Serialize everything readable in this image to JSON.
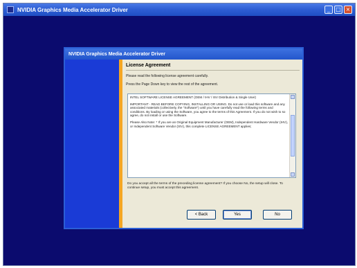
{
  "window": {
    "title": "NVIDIA Graphics Media Accelerator Driver",
    "minimize": "_",
    "maximize": "□",
    "close": "×"
  },
  "dialog": {
    "title": "NVIDIA Graphics Media Accelerator Driver",
    "heading": "License Agreement",
    "instruction_1": "Please read the following license agreement carefully.",
    "instruction_2": "Press the Page Down key to view the rest of the agreement.",
    "license_paragraphs": [
      "INTEL SOFTWARE LICENSE AGREEMENT (OEM / IHV / ISV Distribution & Single User)",
      "IMPORTANT - READ BEFORE COPYING, INSTALLING OR USING. Do not use or load this software and any associated materials (collectively, the \"Software\") until you have carefully read the following terms and conditions. By loading or using the Software, you agree to the terms of this Agreement. If you do not wish to so agree, do not install or use the Software.",
      "Please Also Note: * If you are an Original Equipment Manufacturer (OEM), Independent Hardware Vendor (IHV), or Independent Software Vendor (ISV), this complete LICENSE AGREEMENT applies;"
    ],
    "accept_note": "Do you accept all the terms of the preceding license agreement? If you choose No, the setup will close. To continue setup, you must accept this agreement.",
    "buttons": {
      "back": "< Back",
      "yes": "Yes",
      "no": "No"
    }
  },
  "colors": {
    "desktop": "#0b0b6e",
    "side_panel": "#1a3bd6",
    "accent": "#f5a623",
    "titlebar": "#2f5fd5"
  }
}
